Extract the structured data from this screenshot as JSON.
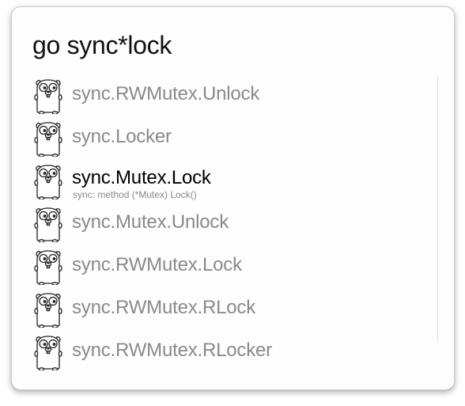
{
  "search": {
    "query": "go sync*lock"
  },
  "results": [
    {
      "title": "sync.RWMutex.Unlock",
      "subtitle": "",
      "icon": "gopher-icon",
      "selected": false
    },
    {
      "title": "sync.Locker",
      "subtitle": "",
      "icon": "gopher-icon",
      "selected": false
    },
    {
      "title": "sync.Mutex.Lock",
      "subtitle": "sync: method (*Mutex) Lock()",
      "icon": "gopher-icon",
      "selected": true
    },
    {
      "title": "sync.Mutex.Unlock",
      "subtitle": "",
      "icon": "gopher-icon",
      "selected": false
    },
    {
      "title": "sync.RWMutex.Lock",
      "subtitle": "",
      "icon": "gopher-icon",
      "selected": false
    },
    {
      "title": "sync.RWMutex.RLock",
      "subtitle": "",
      "icon": "gopher-icon",
      "selected": false
    },
    {
      "title": "sync.RWMutex.RLocker",
      "subtitle": "",
      "icon": "gopher-icon",
      "selected": false
    }
  ],
  "colors": {
    "selected_text": "#000000",
    "unselected_text": "#8a8a8a",
    "panel_background": "#fdfdfd"
  }
}
